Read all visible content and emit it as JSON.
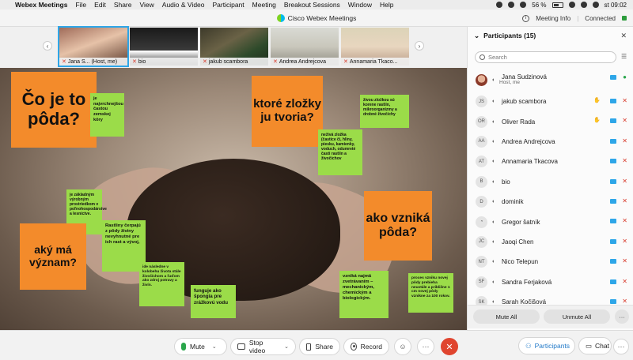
{
  "menubar": {
    "app": "Webex Meetings",
    "items": [
      "File",
      "Edit",
      "Share",
      "View",
      "Audio & Video",
      "Participant",
      "Meeting",
      "Breakout Sessions",
      "Window",
      "Help"
    ],
    "battery": "56 %",
    "clock": "st 09:02"
  },
  "window": {
    "title": "Cisco Webex Meetings",
    "meeting_info": "Meeting Info",
    "status": "Connected"
  },
  "thumbnails": [
    {
      "label": "Jana S... (Host, me)"
    },
    {
      "label": "bio"
    },
    {
      "label": "jakub scambora"
    },
    {
      "label": "Andrea Andrejcova"
    },
    {
      "label": "Annamaria Tkaco..."
    }
  ],
  "slide": {
    "title_q": "Čo je to pôda?",
    "composition_q": "ktoré zložky ju tvoria?",
    "origin_q": "ako vzniká pôda?",
    "meaning_q": "aký má význam?",
    "note1": "je najvrchnejšou častou zemskej kôry",
    "note2": "živou zložkou sú korene rastlín, mikroorganizmy a drobné živočíchy",
    "note3": "neživá zložka (častice či, hliny, piesku, kamienky, voduch, odumreté časti rastlín a živočíchov",
    "note4": "je základným výrobným prostriedkom v poľnohospodárstve a lesníctve.",
    "note5": "Rastliny čerpajú z pôdy živiny nevyhnutné pre ich rast a vývoj,",
    "note6": "ide následne v kolobehu života stále živočíchom a ľuďom ako zdroj potravy a živín.",
    "note7": "funguje ako špongia pre zrážkovú vodu",
    "note8": "vzniká najmä zvetrávaním – mechanickým, chemickým a biologickým.",
    "note9": "proces vzniku novej pôdy prebieha neustále a približne 1 cm novej pôdy vznikne za 100 rokov."
  },
  "controls": {
    "mute": "Mute",
    "stop_video": "Stop video",
    "share": "Share",
    "record": "Record",
    "participants": "Participants",
    "chat": "Chat"
  },
  "panel": {
    "title": "Participants (15)",
    "search_placeholder": "Search",
    "mute_all": "Mute All",
    "unmute_all": "Unmute All",
    "participants": [
      {
        "initials": "",
        "name": "Jana Sudzinová",
        "sub": "Host, me",
        "mic": "green"
      },
      {
        "initials": "JS",
        "name": "jakub scambora",
        "mic": "red"
      },
      {
        "initials": "OR",
        "name": "Oliver Rada",
        "mic": "red"
      },
      {
        "initials": "AA",
        "name": "Andrea Andrejcova",
        "mic": "red"
      },
      {
        "initials": "AT",
        "name": "Annamaria Tkacova",
        "mic": "red"
      },
      {
        "initials": "B",
        "name": "bio",
        "mic": "red"
      },
      {
        "initials": "D",
        "name": "dominik",
        "mic": "red"
      },
      {
        "initials": "",
        "name": "Gregor šatník",
        "mic": "red"
      },
      {
        "initials": "JC",
        "name": "Jaoqi Chen",
        "mic": "red"
      },
      {
        "initials": "NT",
        "name": "Nico Telepun",
        "mic": "red"
      },
      {
        "initials": "SF",
        "name": "Sandra Ferjaková",
        "mic": "red"
      },
      {
        "initials": "SK",
        "name": "Sarah Kočišová",
        "mic": "red"
      }
    ]
  }
}
